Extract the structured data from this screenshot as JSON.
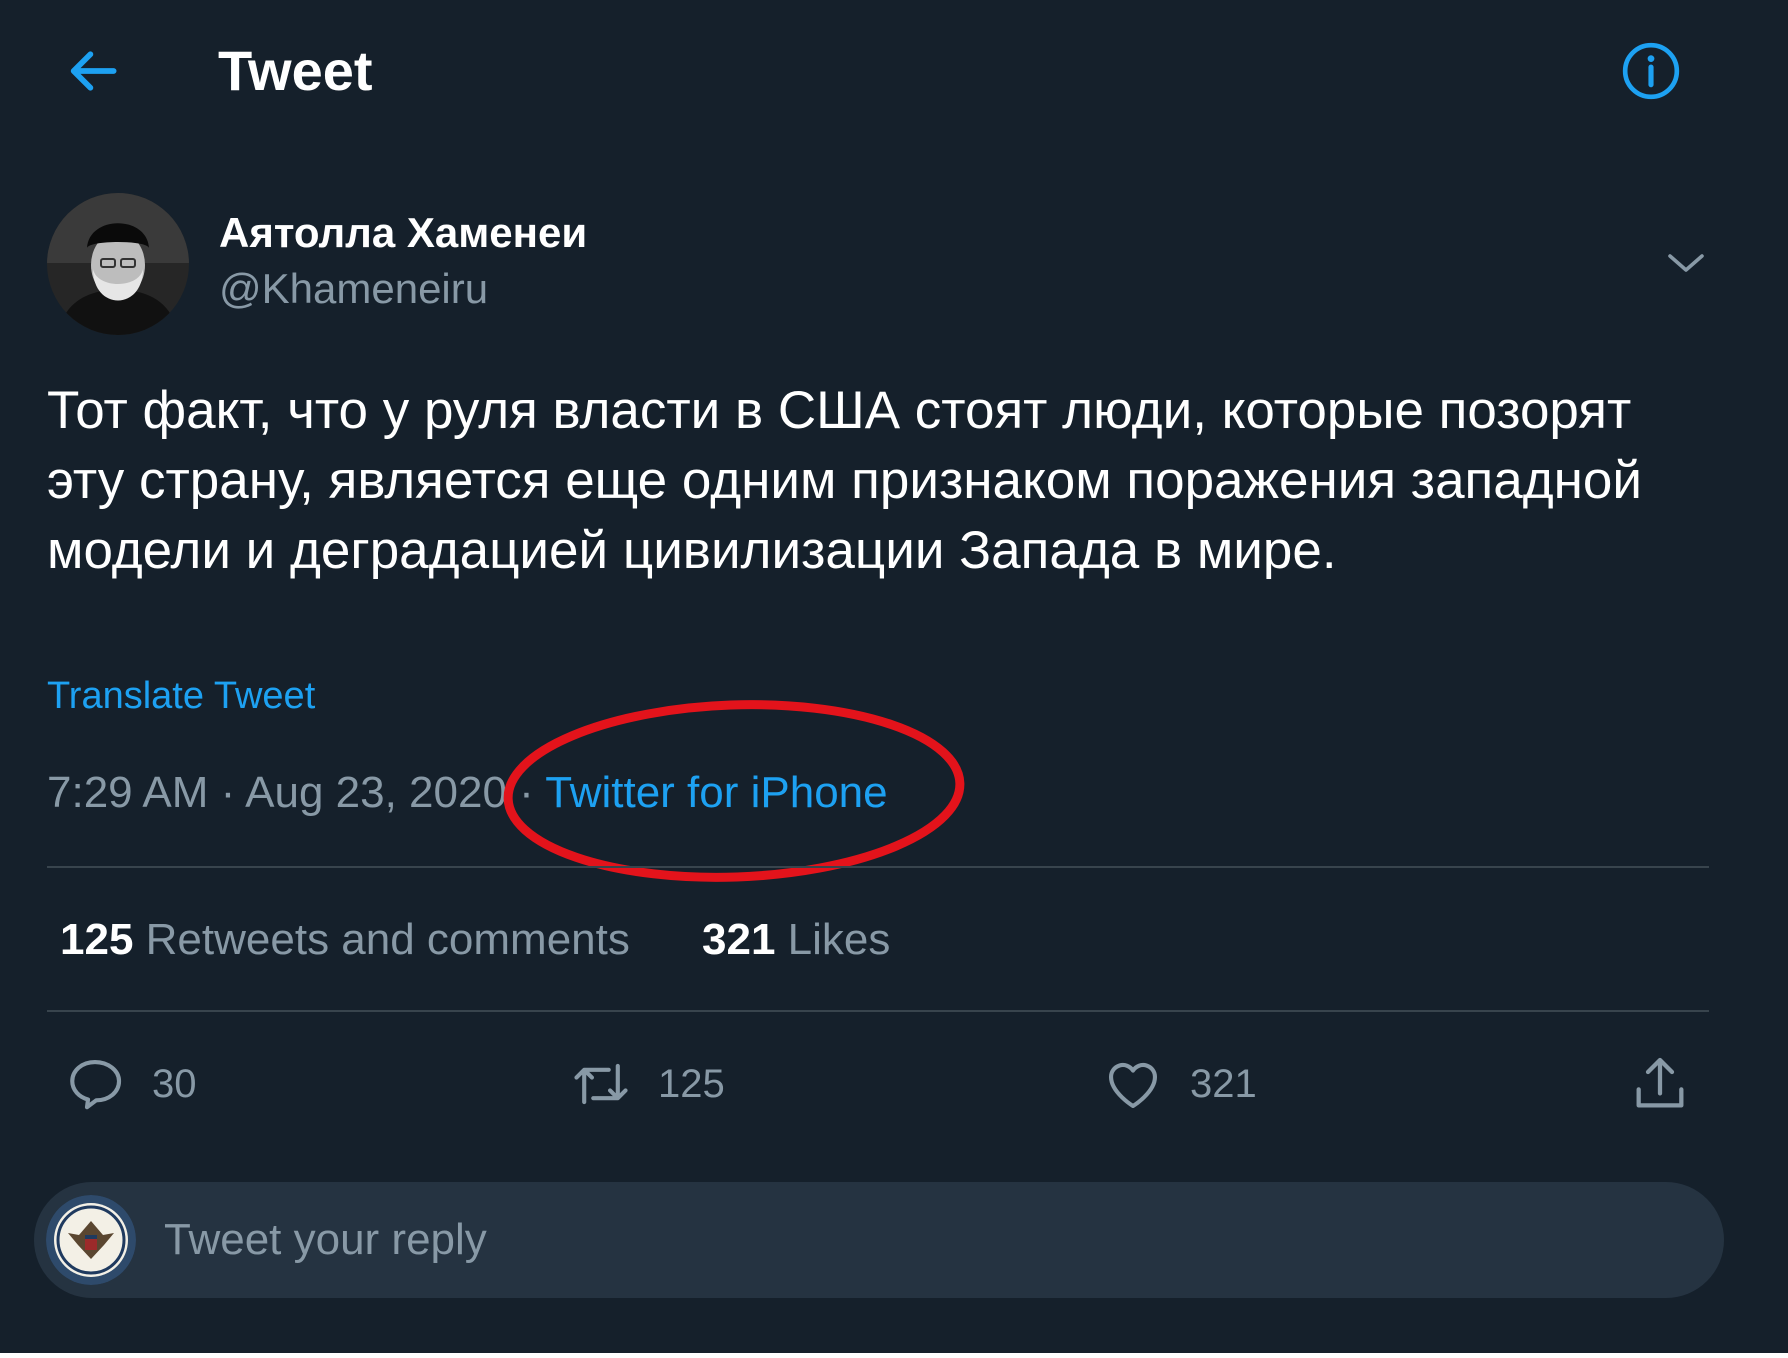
{
  "header": {
    "title": "Tweet",
    "back_icon": "arrow-left-icon",
    "info_icon": "info-icon"
  },
  "author": {
    "name": "Аятолла Хаменеи",
    "handle": "@Khameneiru"
  },
  "tweet": {
    "text": "Тот факт, что у руля власти в США стоят люди, которые позорят эту страну, является еще одним признаком поражения западной модели и деградацией цивилизации Запада в мире.",
    "translate_label": "Translate Tweet",
    "time": "7:29 AM",
    "date": "Aug 23, 2020",
    "separator": "·",
    "source": "Twitter for iPhone"
  },
  "stats": {
    "retweets_count": "125",
    "retweets_label": "Retweets and comments",
    "likes_count": "321",
    "likes_label": "Likes"
  },
  "actions": {
    "reply_count": "30",
    "retweet_count": "125",
    "like_count": "321"
  },
  "reply": {
    "placeholder": "Tweet your reply"
  },
  "colors": {
    "background": "#15202b",
    "accent": "#1da1f2",
    "secondary_text": "#8899a6",
    "divider": "#38444d",
    "annotation": "#e3131b"
  }
}
